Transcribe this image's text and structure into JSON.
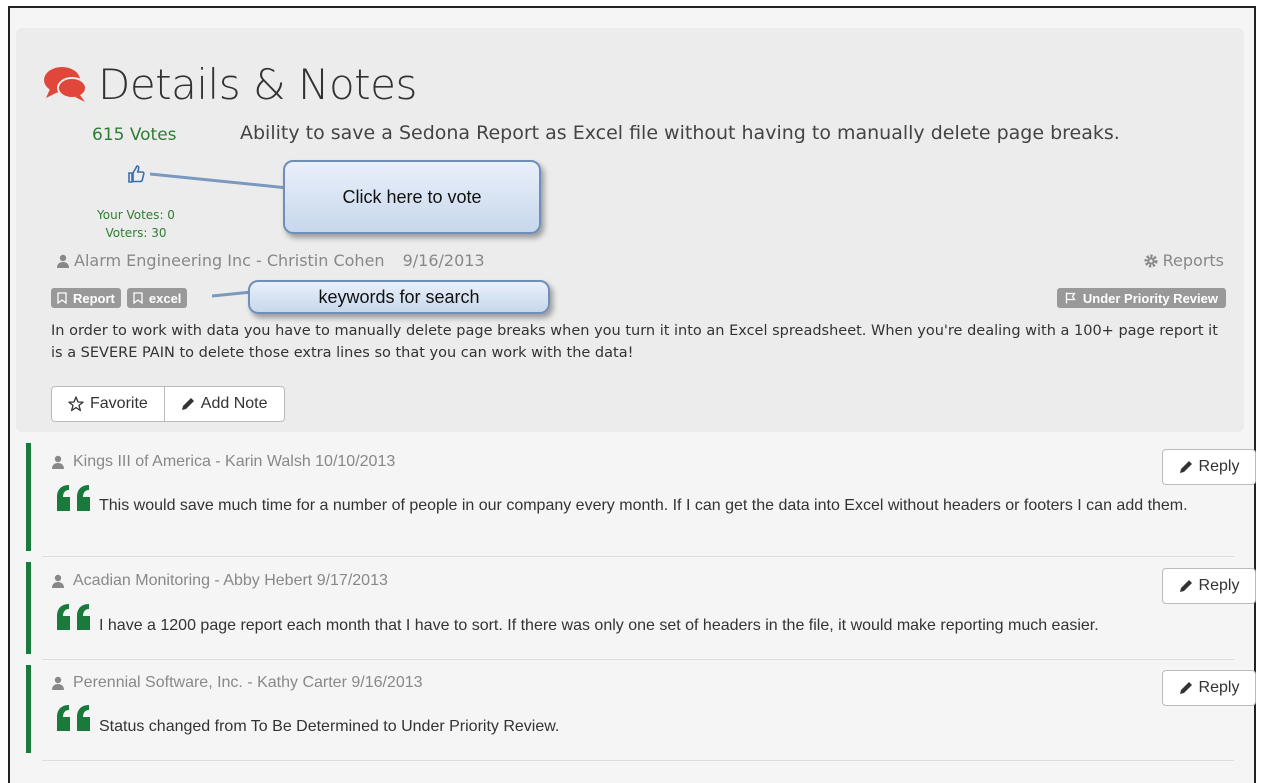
{
  "header": {
    "title": "Details & Notes"
  },
  "idea": {
    "votes_label": "615 Votes",
    "your_votes": "Your Votes: 0",
    "voters": "Voters: 30",
    "title": "Ability to save a Sedona Report as Excel file without having to manually delete page breaks.",
    "author": "Alarm Engineering Inc - Christin Cohen",
    "date": "9/16/2013",
    "category": "Reports",
    "tags": [
      "Report",
      "excel"
    ],
    "status": "Under Priority Review",
    "description": "In order to work with data you have to manually delete page breaks when you turn it into an Excel spreadsheet. When you're dealing with a 100+ page report it is a SEVERE PAIN to delete those extra lines so that you can work with the data!"
  },
  "actions": {
    "favorite_label": "Favorite",
    "add_note_label": "Add Note",
    "reply_label": "Reply"
  },
  "callouts": {
    "vote": "Click here to vote",
    "keywords": "keywords for search"
  },
  "notes": [
    {
      "author_line": "Kings III of America - Karin Walsh 10/10/2013",
      "text": "This would save much time for a number of people in our company every month. If I can get the data into Excel without headers or footers I can add them."
    },
    {
      "author_line": "Acadian Monitoring - Abby Hebert 9/17/2013",
      "text": "I have a 1200 page report each month that I have to sort. If there was only one set of headers in the file, it would make reporting much easier."
    },
    {
      "author_line": "Perennial Software, Inc. - Kathy Carter 9/16/2013",
      "text": "Status changed from To Be Determined to Under Priority Review."
    }
  ],
  "colors": {
    "accent_green": "#2e7d32",
    "note_bar": "#1a7a3c",
    "title_icon": "#e0463a",
    "thumb": "#3a6fb0",
    "badge": "#999999"
  },
  "icons": [
    "comments-icon",
    "thumbs-up-icon",
    "person-icon",
    "gear-icon",
    "bookmark-icon",
    "flag-icon",
    "star-icon",
    "pencil-icon",
    "quote-icon"
  ]
}
